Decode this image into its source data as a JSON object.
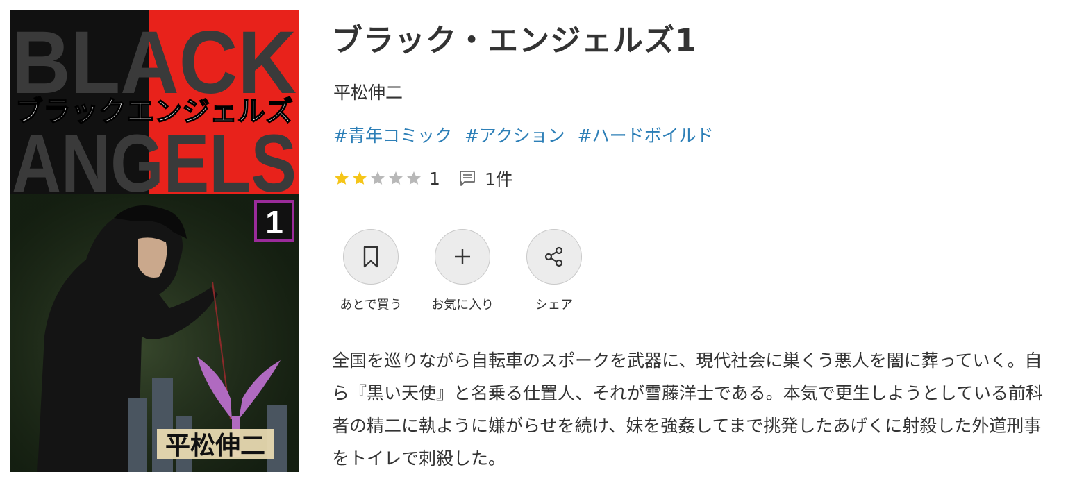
{
  "cover": {
    "title_en_line1": "BLACK",
    "title_en_line2": "ANGELS",
    "title_jp": "ブラックエンジェルズ",
    "volume": "1",
    "author": "平松伸二"
  },
  "book": {
    "title": "ブラック・エンジェルズ1",
    "author": "平松伸二",
    "tags": [
      "#青年コミック",
      "#アクション",
      "#ハードボイルド"
    ],
    "rating": {
      "stars_filled": 2,
      "stars_total": 5,
      "value": "1"
    },
    "review_count": "1件",
    "description": "全国を巡りながら自転車のスポークを武器に、現代社会に巣くう悪人を闇に葬っていく。自ら『黒い天使』と名乗る仕置人、それが雪藤洋士である。本気で更生しようとしている前科者の精二に執ように嫌がらせを続け、妹を強姦してまで挑発したあげくに射殺した外道刑事をトイレで刺殺した。"
  },
  "actions": [
    {
      "label": "あとで買う",
      "icon": "bookmark-icon"
    },
    {
      "label": "お気に入り",
      "icon": "plus-icon"
    },
    {
      "label": "シェア",
      "icon": "share-icon"
    }
  ],
  "colors": {
    "tag": "#2d7fb7",
    "star_filled": "#f5c518",
    "star_empty": "#b8b8b8",
    "cover_red": "#e8221b",
    "cover_green": "#1c2a18"
  }
}
